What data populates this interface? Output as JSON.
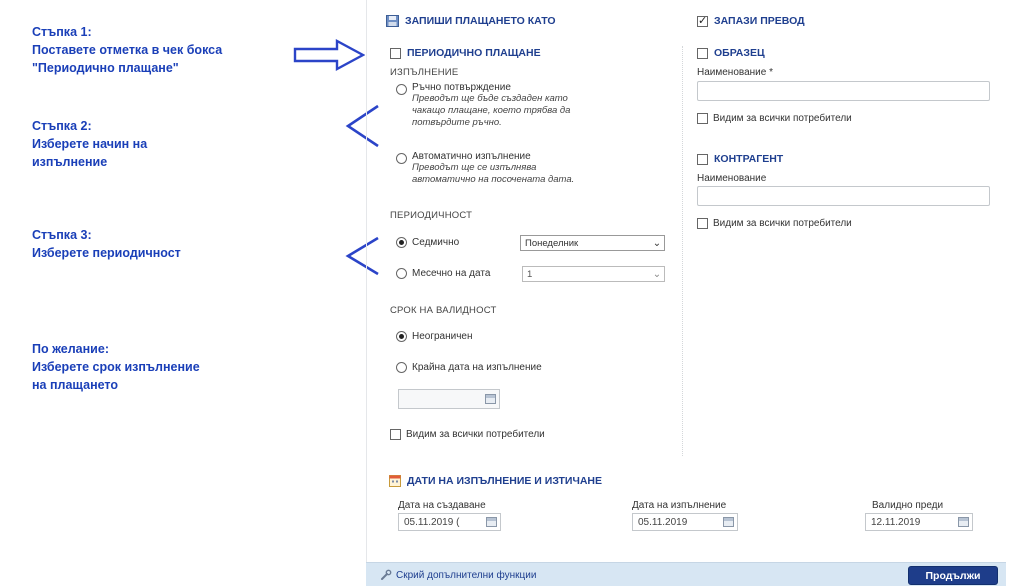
{
  "instructions": {
    "step1_title": "Стъпка 1:",
    "step1_line1": "Поставете отметка в чек бокса",
    "step1_line2": "\"Периодично плащане\"",
    "step2_title": "Стъпка 2:",
    "step2_line1": "Изберете начин на",
    "step2_line2": "изпълнение",
    "step3_title": "Стъпка 3:",
    "step3_line1": "Изберете периодичност",
    "optional_title": "По желание:",
    "optional_line1": "Изберете срок изпълнение",
    "optional_line2": "на плащането"
  },
  "save_payment": {
    "title": "ЗАПИШИ ПЛАЩАНЕТО КАТО",
    "periodic_label": "ПЕРИОДИЧНО ПЛАЩАНЕ",
    "periodic_checked": false,
    "execution_caption": "ИЗПЪЛНЕНИЕ",
    "manual_label": "Ръчно потвърждение",
    "manual_hint1": "Преводът ще бъде създаден като",
    "manual_hint2": "чакащо плащане, което трябва да",
    "manual_hint3": "потвърдите ръчно.",
    "auto_label": "Автоматично изпълнение",
    "auto_hint1": "Преводът ще се изпълнява",
    "auto_hint2": "автоматично на посочената дата.",
    "periodicity_caption": "ПЕРИОДИЧНОСТ",
    "weekly_label": "Седмично",
    "weekly_value": "Понеделник",
    "monthly_label": "Месечно на дата",
    "monthly_value": "1",
    "validity_caption": "СРОК НА ВАЛИДНОСТ",
    "unlimited_label": "Неограничен",
    "end_date_label": "Крайна дата на изпълнение",
    "visible_all_label": "Видим за всички потребители"
  },
  "save_transfer": {
    "title": "ЗАПАЗИ ПРЕВОД",
    "checked": true,
    "template_label": "ОБРАЗЕЦ",
    "name_required_label": "Наименование *",
    "visible_all_label_1": "Видим за всички потребители",
    "counterparty_label": "КОНТРАГЕНТ",
    "name_label": "Наименование",
    "visible_all_label_2": "Видим за всички потребители"
  },
  "dates": {
    "title": "ДАТИ НА ИЗПЪЛНЕНИЕ И ИЗТИЧАНЕ",
    "created_label": "Дата на създаване",
    "created_value": "05.11.2019 (",
    "exec_label": "Дата на изпълнение",
    "exec_value": "05.11.2019",
    "valid_label": "Валидно преди",
    "valid_value": "12.11.2019"
  },
  "footer": {
    "hide_label": "Скрий допълнителни функции",
    "continue_label": "Продължи"
  },
  "colors": {
    "instruction_blue": "#1a3fb8",
    "section_blue": "#1f3f8f",
    "button_navy": "#1e3d8a",
    "footer_bg": "#d7e6f3"
  }
}
